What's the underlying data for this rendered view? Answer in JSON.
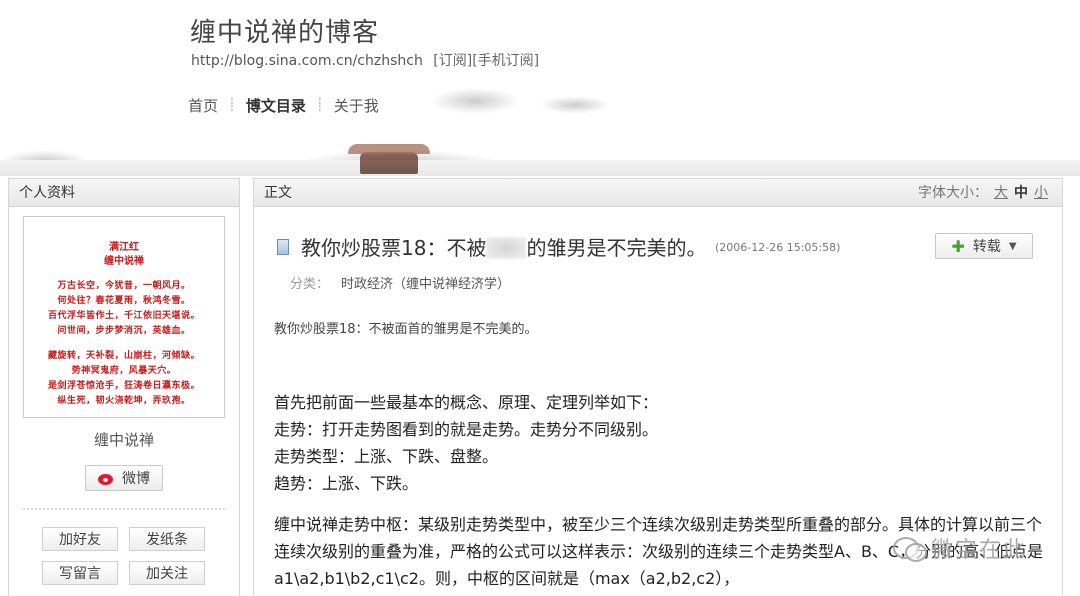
{
  "header": {
    "blog_title": "缠中说禅的博客",
    "url": "http://blog.sina.com.cn/chzhshch",
    "subscribe": "[订阅]",
    "mobile_subscribe": "[手机订阅]"
  },
  "nav": {
    "items": [
      "首页",
      "博文目录",
      "关于我"
    ],
    "separator": "┊"
  },
  "sidebar": {
    "title": "个人资料",
    "poem": {
      "title": "满江红",
      "author": "缠中说禅",
      "lines": [
        "万古长空，今犹昔，一朝风月。",
        "何处往？春花夏雨，秋鸿冬雪。",
        "百代浮华皆作土，千江依旧天堪说。",
        "问世间，步步梦消沉，英雄血。",
        "",
        "藏旋转，天补裂，山崩柱，河倾缺。",
        "势神冥鬼府，风暴天穴。",
        "是剑浮苍惊沧手，狂涛卷日瀛东极。",
        "纵生死，韧火浇乾坤，弄玖孢。"
      ]
    },
    "name": "缠中说禅",
    "weibo_label": "微博",
    "buttons": {
      "add_friend": "加好友",
      "send_note": "发纸条",
      "write_message": "写留言",
      "follow": "加关注"
    }
  },
  "main": {
    "panel_title": "正文",
    "font_size": {
      "label": "字体大小：",
      "large": "大",
      "medium": "中",
      "small": "小"
    },
    "post": {
      "title_prefix": "教你炒股票18：不被",
      "title_suffix": "的雏男是不完美的。",
      "date": "(2006-12-26 15:05:58)",
      "repost_label": "转载",
      "category_label": "分类：",
      "category": "时政经济（缠中说禅经济学）",
      "intro": "教你炒股票18：不被面首的雏男是不完美的。",
      "lines": [
        "首先把前面一些最基本的概念、原理、定理列举如下：",
        "走势：打开走势图看到的就是走势。走势分不同级别。",
        "走势类型：上涨、下跌、盘整。",
        "趋势：上涨、下跌。"
      ],
      "para2": "缠中说禅走势中枢：某级别走势类型中，被至少三个连续次级别走势类型所重叠的部分。具体的计算以前三个连续次级别的重叠为准，严格的公式可以这样表示：次级别的连续三个走势类型A、B、C，分别的高、低点是a1\\a2,b1\\b2,c1\\c2。则，中枢的区间就是（max（a2,b2,c2），"
    }
  },
  "watermark": "微宝在此",
  "icons": {
    "post": "document-icon",
    "weibo": "weibo-logo-icon",
    "repost": "plus-icon",
    "dropdown": "caret-down-icon",
    "watermark": "wechat-icon"
  }
}
